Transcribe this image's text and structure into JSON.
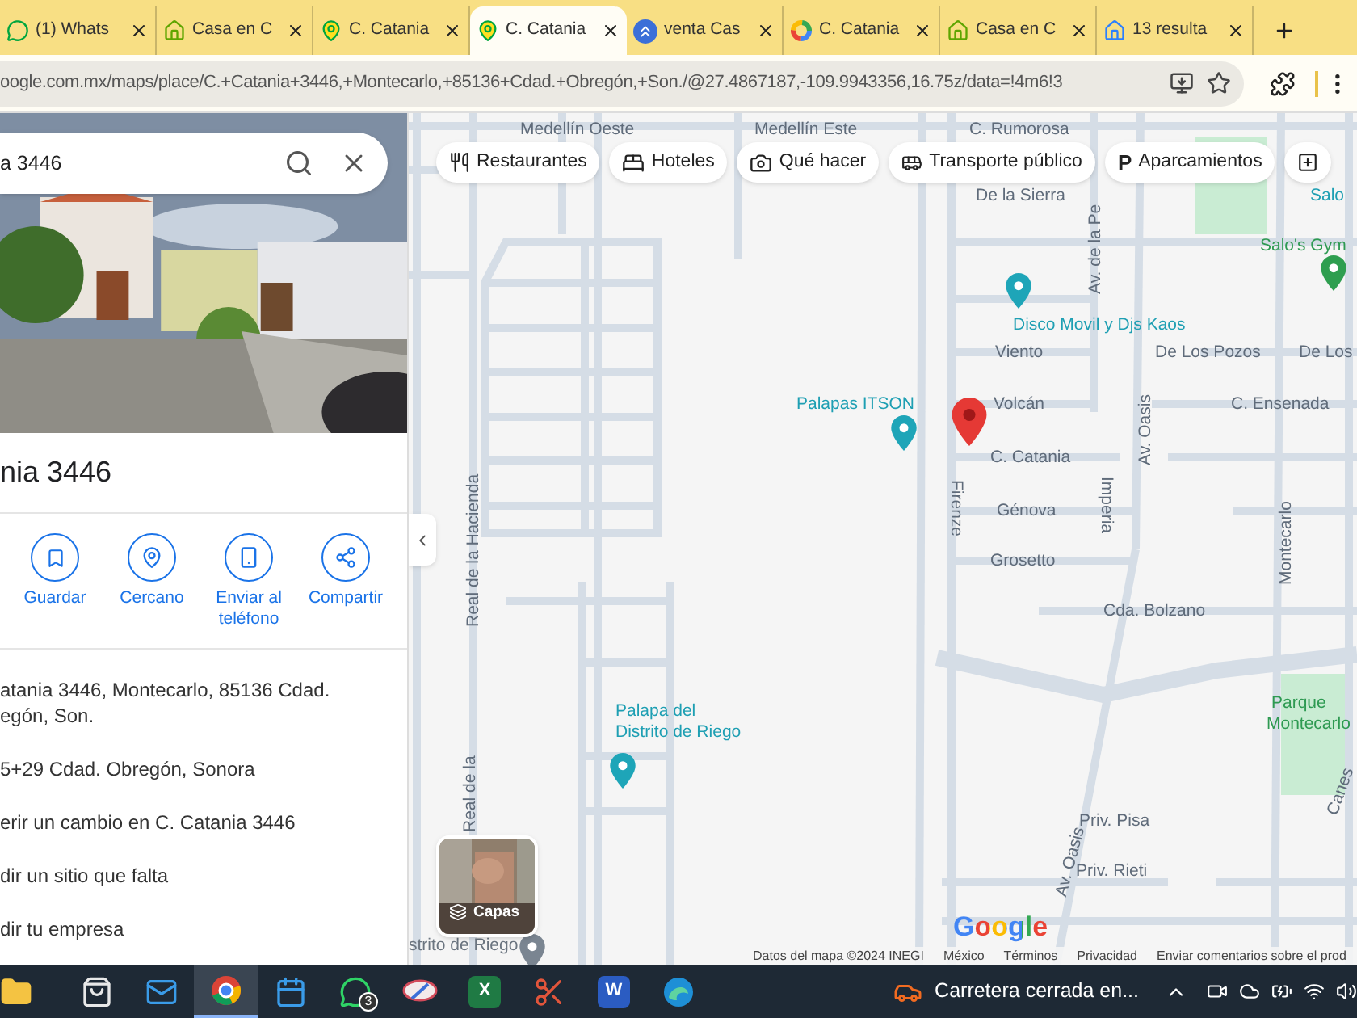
{
  "tabs": [
    {
      "title": "(1) Whats",
      "kind": "chat",
      "selected": false
    },
    {
      "title": "Casa en C",
      "kind": "listing",
      "selected": false
    },
    {
      "title": "C. Catania",
      "kind": "map",
      "selected": false
    },
    {
      "title": "C. Catania",
      "kind": "map",
      "selected": true
    },
    {
      "title": "venta Cas",
      "kind": "chevrons",
      "selected": false
    },
    {
      "title": "C. Catania",
      "kind": "ring",
      "selected": false
    },
    {
      "title": "Casa en C",
      "kind": "listing",
      "selected": false
    },
    {
      "title": "13 resulta",
      "kind": "home",
      "selected": false
    }
  ],
  "address_bar": {
    "url": "oogle.com.mx/maps/place/C.+Catania+3446,+Montecarlo,+85136+Cdad.+Obregón,+Son./@27.4867187,-109.9943356,16.75z/data=!4m6!3"
  },
  "place_panel": {
    "search": {
      "value": "a 3446"
    },
    "title": "nia 3446",
    "actions": [
      {
        "label": "Guardar",
        "kind": "save"
      },
      {
        "label": "Cercano",
        "kind": "nearby"
      },
      {
        "label": "Enviar al teléfono",
        "kind": "phone"
      },
      {
        "label": "Compartir",
        "kind": "share"
      }
    ],
    "details": [
      {
        "lines": [
          "atania 3446, Montecarlo, 85136 Cdad.",
          "egón, Son."
        ]
      },
      {
        "lines": [
          "5+29 Cdad. Obregón, Sonora"
        ]
      },
      {
        "lines": [
          "erir un cambio en C. Catania 3446"
        ]
      },
      {
        "lines": [
          "dir un sitio que falta"
        ]
      },
      {
        "lines": [
          "dir tu empresa"
        ]
      }
    ]
  },
  "map": {
    "chips": [
      {
        "label": "Restaurantes",
        "kind": "utensils"
      },
      {
        "label": "Hoteles",
        "kind": "bed"
      },
      {
        "label": "Qué hacer",
        "kind": "camera"
      },
      {
        "label": "Transporte público",
        "kind": "bus"
      },
      {
        "label": "Aparcamientos",
        "kind": "glyph",
        "glyph": "P"
      },
      {
        "kind": "more"
      }
    ],
    "labels": [
      {
        "text": "Medellín Oeste",
        "kind": "street"
      },
      {
        "text": "Medellín Este",
        "kind": "street"
      },
      {
        "text": "C. Rumorosa",
        "kind": "street"
      },
      {
        "text": "De la Sierra",
        "kind": "street"
      },
      {
        "text": "Av. de la Pe",
        "kind": "street"
      },
      {
        "text": "Salo",
        "kind": "place"
      },
      {
        "text": "Salo's Gym",
        "kind": "park"
      },
      {
        "text": "Disco Movil y Djs Kaos",
        "kind": "place"
      },
      {
        "text": "Viento",
        "kind": "street"
      },
      {
        "text": "De Los Pozos",
        "kind": "street"
      },
      {
        "text": "De Los",
        "kind": "street"
      },
      {
        "text": "Palapas ITSON",
        "kind": "place"
      },
      {
        "text": "Volcán",
        "kind": "street"
      },
      {
        "text": "C. Ensenada",
        "kind": "street"
      },
      {
        "text": "C. Catania",
        "kind": "street"
      },
      {
        "text": "Génova",
        "kind": "street"
      },
      {
        "text": "Grosetto",
        "kind": "street"
      },
      {
        "text": "Cda. Bolzano",
        "kind": "street"
      },
      {
        "text": "Firenze",
        "kind": "street"
      },
      {
        "text": "Imperia",
        "kind": "street"
      },
      {
        "text": "Av. Oasis",
        "kind": "street"
      },
      {
        "text": "Montecarlo",
        "kind": "street"
      },
      {
        "text": "Real de la Hacienda",
        "kind": "street"
      },
      {
        "text": "Real de la",
        "kind": "street"
      },
      {
        "text": "Palapa del",
        "kind": "place"
      },
      {
        "text": "Distrito de Riego",
        "kind": "place"
      },
      {
        "text": "Parque",
        "kind": "park"
      },
      {
        "text": "Montecarlo",
        "kind": "park"
      },
      {
        "text": "Canes",
        "kind": "street"
      },
      {
        "text": "Priv. Pisa",
        "kind": "street"
      },
      {
        "text": "Priv. Rieti",
        "kind": "street"
      },
      {
        "text": "Av. Oasis",
        "kind": "street"
      },
      {
        "text": "strito de Riego",
        "kind": "area"
      }
    ],
    "pins": [
      {
        "kind": "selected"
      },
      {
        "kind": "place"
      },
      {
        "kind": "place"
      },
      {
        "kind": "place"
      },
      {
        "kind": "park"
      },
      {
        "kind": "area"
      }
    ],
    "layers_button": {
      "label": "Capas"
    },
    "logo": "Google",
    "footer": [
      "Datos del mapa ©2024 INEGI",
      "México",
      "Términos",
      "Privacidad",
      "Enviar comentarios sobre el prod"
    ]
  },
  "taskbar": {
    "apps": [
      {
        "kind": "folder",
        "selected": false
      },
      {
        "kind": "store",
        "selected": false
      },
      {
        "kind": "mail",
        "selected": false
      },
      {
        "kind": "chrome",
        "selected": true
      },
      {
        "kind": "calendar",
        "selected": false
      },
      {
        "kind": "chat",
        "selected": false,
        "badge": "3"
      },
      {
        "kind": "snip",
        "selected": false
      },
      {
        "kind": "sheet",
        "selected": false,
        "glyph": "X"
      },
      {
        "kind": "scissors",
        "selected": false
      },
      {
        "kind": "doc",
        "selected": false,
        "glyph": "W"
      },
      {
        "kind": "edge",
        "selected": false
      }
    ],
    "notification": "Carretera cerrada en..."
  }
}
